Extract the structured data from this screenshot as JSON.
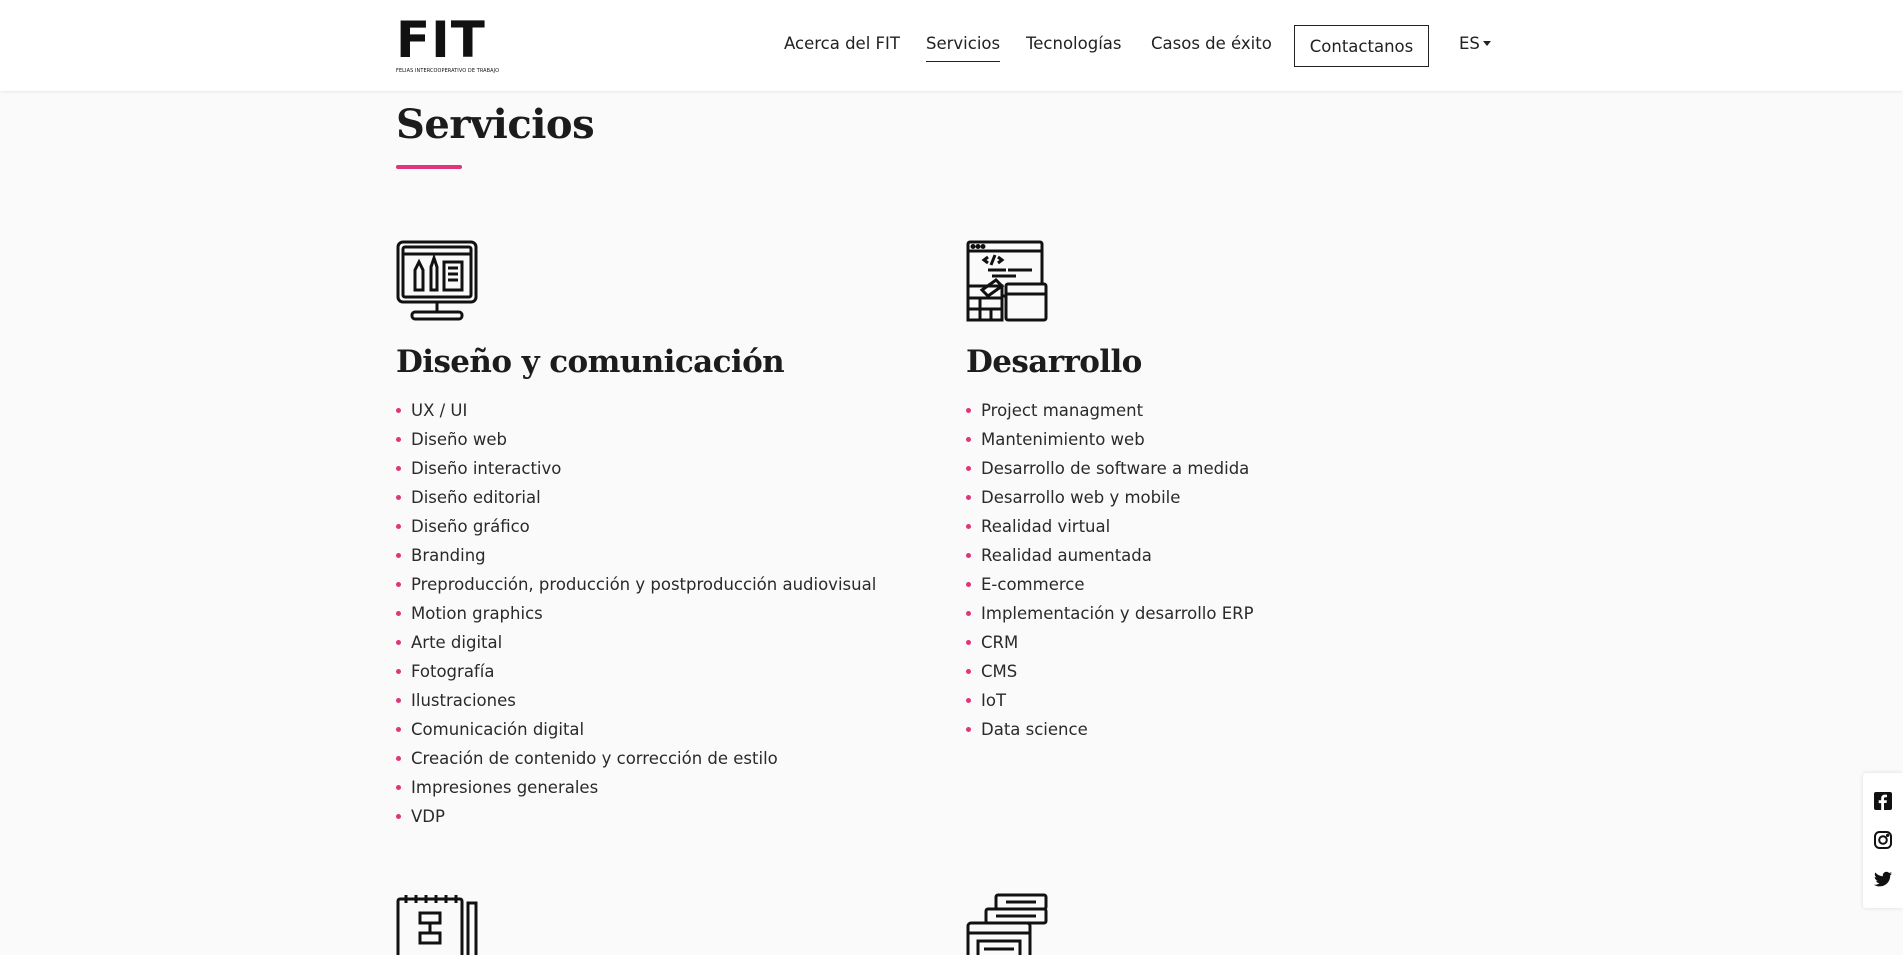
{
  "header": {
    "logo": {
      "mark": "FIT",
      "subtitle": "FELIAS INTERCOOPERATIVO DE TRABAJO"
    },
    "nav": [
      {
        "label": "Acerca del FIT",
        "active": false
      },
      {
        "label": "Servicios",
        "active": true
      },
      {
        "label": "Tecnologías",
        "active": false
      },
      {
        "label": "Casos de éxito",
        "active": false
      }
    ],
    "contact_label": "Contactanos",
    "language": "ES"
  },
  "page": {
    "title": "Servicios",
    "accent_color": "#e0357a"
  },
  "services": [
    {
      "icon": "design-monitor-icon",
      "title": "Diseño y comunicación",
      "items": [
        "UX / UI",
        "Diseño web",
        "Diseño interactivo",
        "Diseño editorial",
        "Diseño gráfico",
        "Branding",
        "Preproducción, producción y postproducción audiovisual",
        "Motion graphics",
        "Arte digital",
        "Fotografía",
        "Ilustraciones",
        "Comunicación digital",
        "Creación de contenido y corrección de estilo",
        "Impresiones generales",
        "VDP"
      ]
    },
    {
      "icon": "development-code-icon",
      "title": "Desarrollo",
      "items": [
        "Project managment",
        "Mantenimiento web",
        "Desarrollo de software a medida",
        "Desarrollo web y mobile",
        "Realidad virtual",
        "Realidad aumentada",
        "E-commerce",
        "Implementación y desarrollo ERP",
        "CRM",
        "CMS",
        "IoT",
        "Data science"
      ]
    }
  ],
  "social": [
    "facebook-icon",
    "instagram-icon",
    "twitter-icon"
  ]
}
